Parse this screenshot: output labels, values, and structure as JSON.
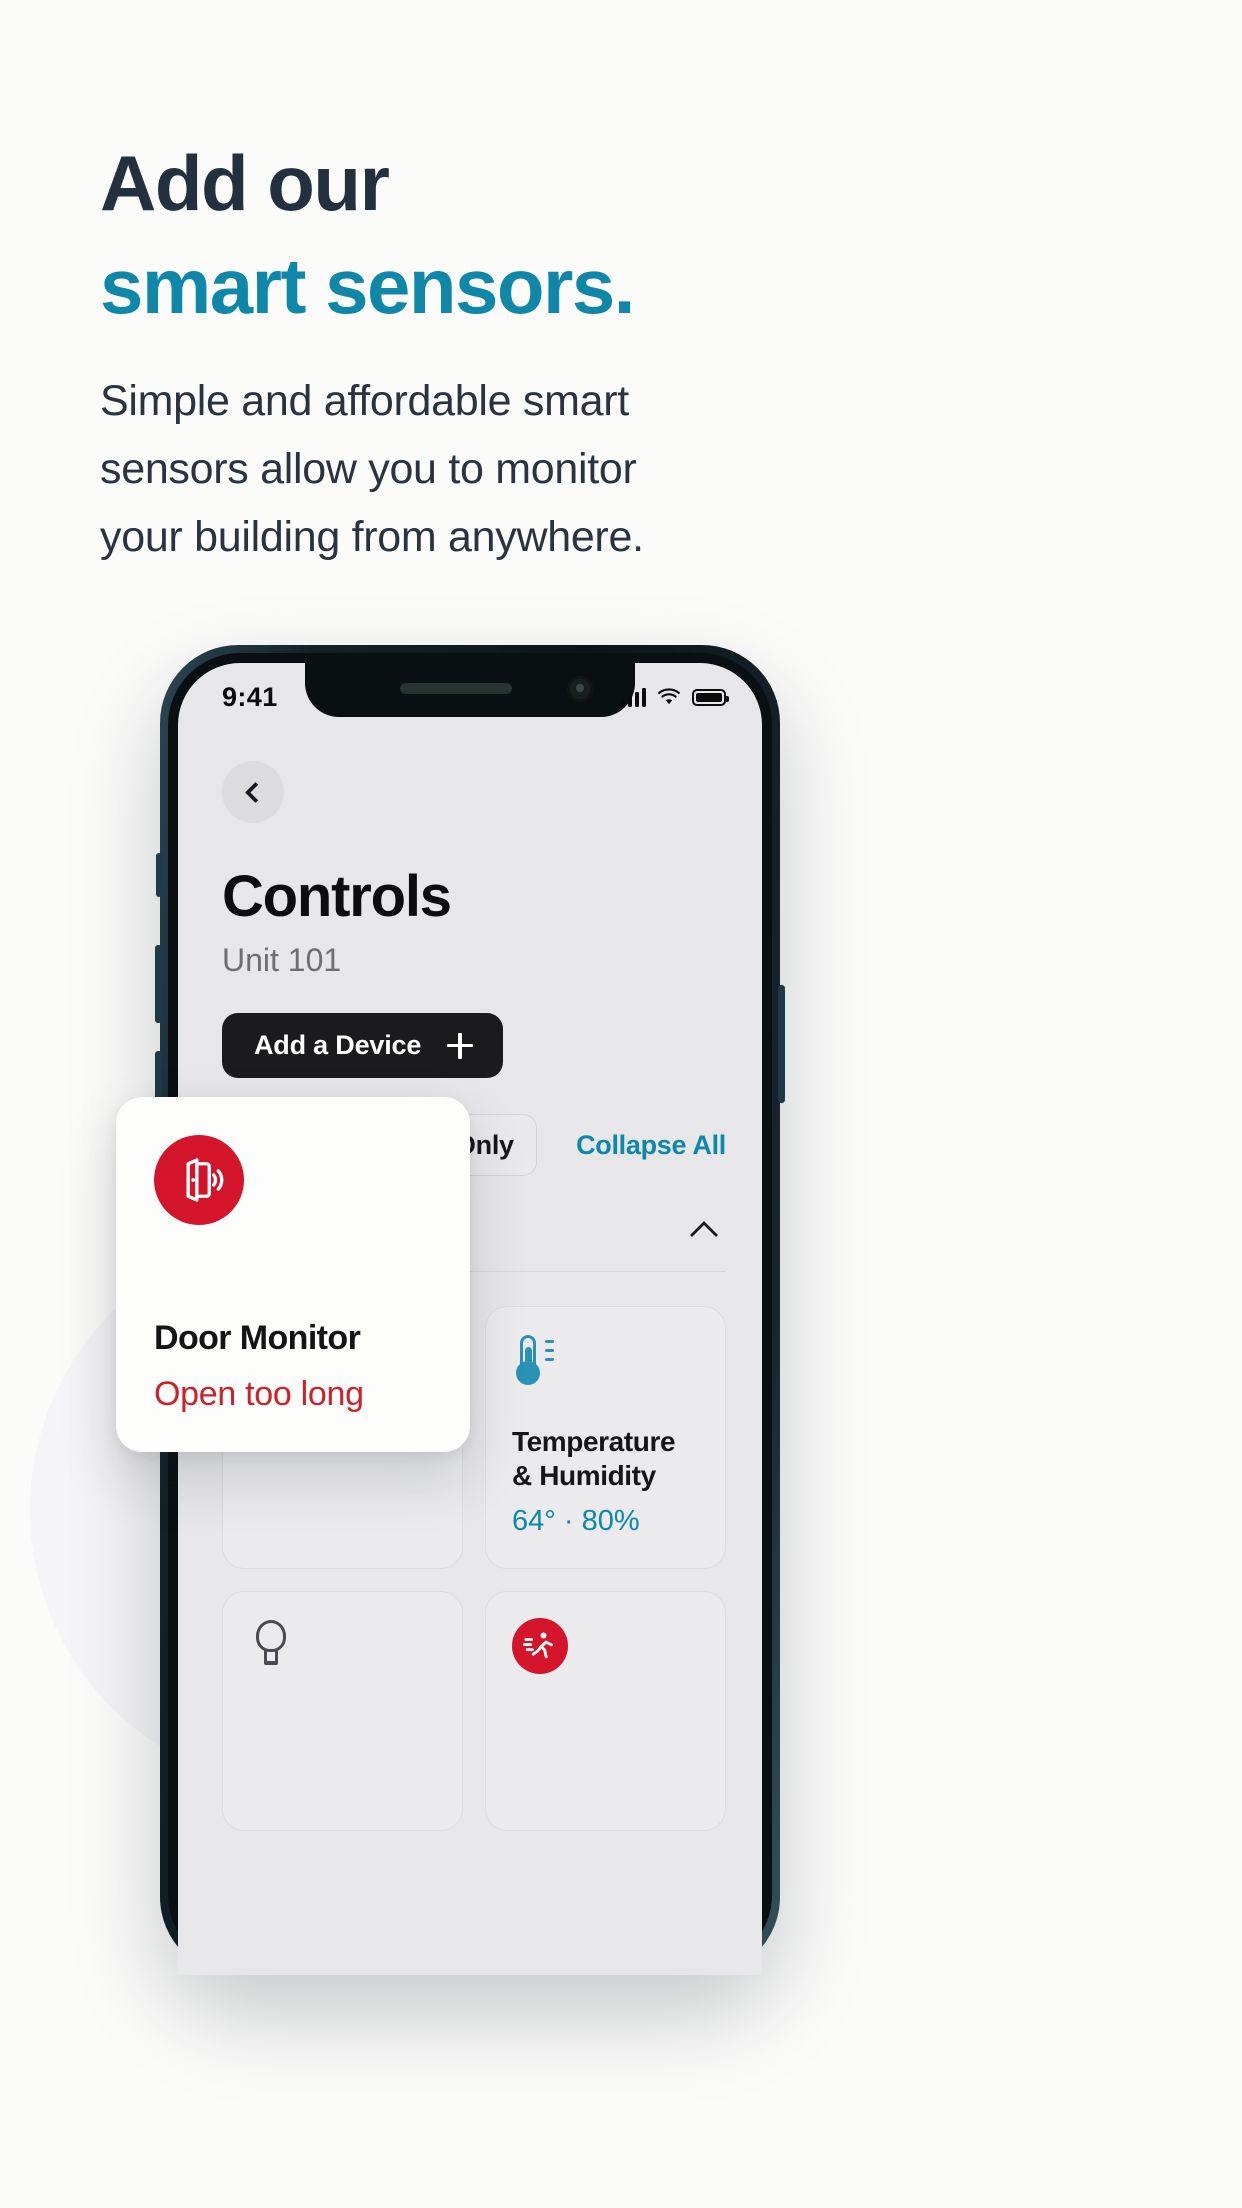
{
  "hero": {
    "headline_line1": "Add our",
    "headline_line2": "smart sensors.",
    "body": "Simple and affordable smart sensors allow you to monitor your building from anywhere.",
    "accent_color": "#0f87a8",
    "heading_color": "#22303f"
  },
  "phone": {
    "status_bar": {
      "time": "9:41",
      "signal_icon": "cellular-bars-icon",
      "wifi_icon": "wifi-icon",
      "battery_icon": "battery-full-icon"
    },
    "screen": {
      "back_icon": "chevron-left-icon",
      "title": "Controls",
      "subtitle": "Unit 101",
      "add_device_label": "Add a Device",
      "add_device_icon": "plus-icon",
      "filters": {
        "settings_icon": "sliders-icon",
        "alerts_chip_icon": "alert-circle-icon",
        "alerts_chip_label": "Alerts Only",
        "collapse_all_label": "Collapse All",
        "collapse_section_icon": "chevron-up-icon"
      },
      "devices": [
        {
          "icon": "thermometer-icon",
          "title": "Temperature & Humidity",
          "value": "64° · 80%"
        },
        {
          "icon": "lightbulb-icon",
          "title": "",
          "value": ""
        },
        {
          "icon": "motion-sensor-icon",
          "title": "",
          "value": ""
        }
      ]
    }
  },
  "overlay_card": {
    "icon": "door-sensor-icon",
    "icon_bg": "#d3142a",
    "title": "Door Monitor",
    "status": "Open too long",
    "status_color": "#cc2229"
  }
}
